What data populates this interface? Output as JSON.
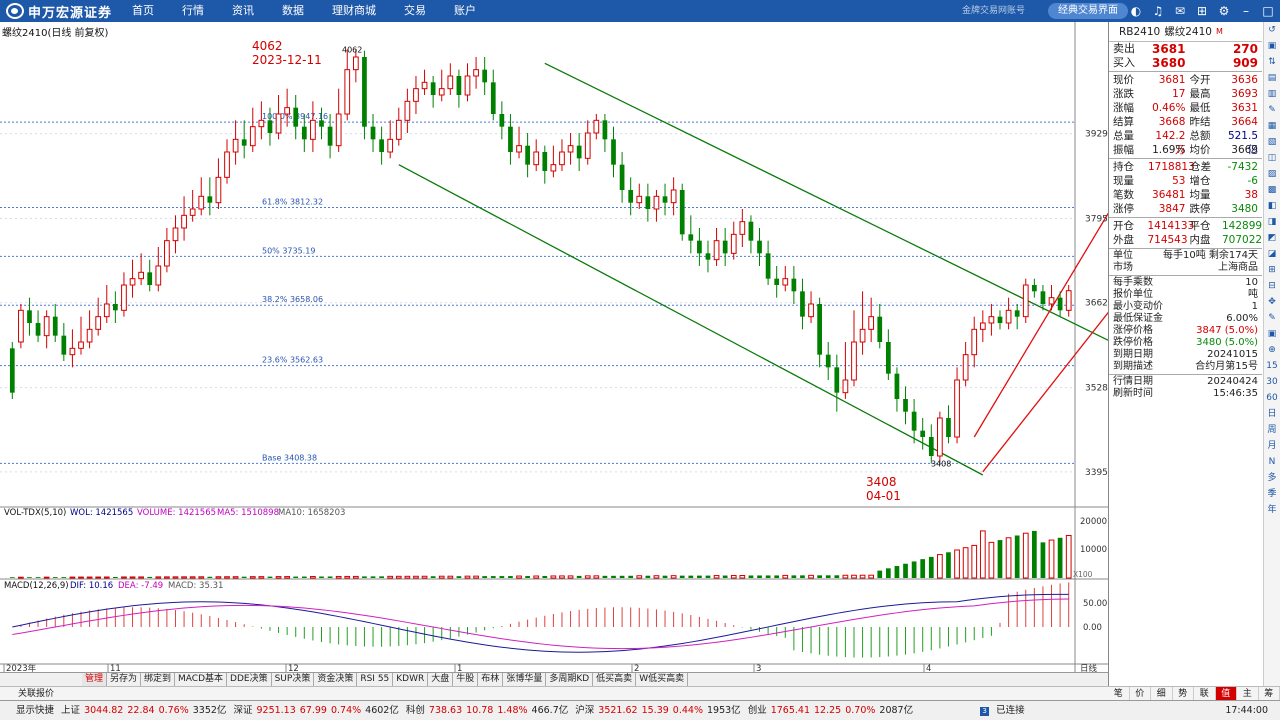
{
  "app": {
    "brand": "申万宏源证券",
    "nav": [
      "首页",
      "行情",
      "资讯",
      "数据",
      "理财商城",
      "交易",
      "账户"
    ],
    "top_small": "金牌交易网账号",
    "classic_btn": "经典交易界面"
  },
  "chart": {
    "title": "螺纹2410(日线 前复权)",
    "hi_label": "4062",
    "hi_date": "2023-12-11",
    "hi_tag": "4062",
    "lo_label": "3408",
    "lo_date": "04-01",
    "lo_tag": "3408",
    "price_axis": [
      "3929",
      "3795",
      "3662",
      "3528",
      "3395"
    ],
    "fib": [
      "100.0% 3947.16",
      "61.8% 3812.32",
      "50% 3735.19",
      "38.2% 3658.06",
      "23.6% 3562.63",
      "Base 3408.38"
    ],
    "vol_label": "VOL-TDX(5,10)",
    "wol": "WOL: 1421565",
    "volume": "VOLUME: 1421565",
    "ma5": "MA5: 1510898",
    "ma10": "MA10: 1658203",
    "vol_axis": [
      "20000",
      "10000",
      "X100"
    ],
    "macd_label": "MACD(12,26,9)",
    "dif": "DIF: 10.16",
    "dea": "DEA: -7.49",
    "macd": "MACD: 35.31",
    "macd_axis": [
      "50.00",
      "0.00"
    ],
    "months": [
      "2023年",
      "11",
      "12",
      "1",
      "2",
      "3",
      "4"
    ],
    "period": "日线"
  },
  "chart_data": {
    "type": "candlestick",
    "title": "螺纹2410(日线 前复权)",
    "ylim": [
      3360,
      4080
    ],
    "candles": [
      [
        3590,
        3520,
        3600,
        3510
      ],
      [
        3600,
        3650,
        3660,
        3590
      ],
      [
        3650,
        3630,
        3670,
        3610
      ],
      [
        3630,
        3610,
        3650,
        3600
      ],
      [
        3610,
        3640,
        3650,
        3590
      ],
      [
        3640,
        3610,
        3660,
        3600
      ],
      [
        3610,
        3580,
        3630,
        3570
      ],
      [
        3580,
        3590,
        3620,
        3560
      ],
      [
        3590,
        3600,
        3640,
        3580
      ],
      [
        3600,
        3620,
        3650,
        3590
      ],
      [
        3620,
        3640,
        3670,
        3610
      ],
      [
        3640,
        3660,
        3690,
        3630
      ],
      [
        3660,
        3650,
        3680,
        3630
      ],
      [
        3650,
        3690,
        3710,
        3640
      ],
      [
        3690,
        3700,
        3730,
        3670
      ],
      [
        3700,
        3710,
        3740,
        3690
      ],
      [
        3710,
        3690,
        3730,
        3680
      ],
      [
        3690,
        3720,
        3750,
        3680
      ],
      [
        3720,
        3760,
        3780,
        3710
      ],
      [
        3760,
        3780,
        3800,
        3740
      ],
      [
        3780,
        3800,
        3830,
        3760
      ],
      [
        3800,
        3810,
        3840,
        3790
      ],
      [
        3810,
        3830,
        3860,
        3800
      ],
      [
        3830,
        3820,
        3860,
        3800
      ],
      [
        3820,
        3860,
        3890,
        3810
      ],
      [
        3860,
        3900,
        3920,
        3850
      ],
      [
        3900,
        3920,
        3950,
        3880
      ],
      [
        3920,
        3910,
        3950,
        3890
      ],
      [
        3910,
        3940,
        3970,
        3900
      ],
      [
        3940,
        3950,
        3980,
        3920
      ],
      [
        3950,
        3930,
        3970,
        3910
      ],
      [
        3930,
        3960,
        3990,
        3920
      ],
      [
        3960,
        3970,
        4000,
        3940
      ],
      [
        3970,
        3940,
        3990,
        3920
      ],
      [
        3940,
        3920,
        3960,
        3900
      ],
      [
        3920,
        3950,
        3980,
        3900
      ],
      [
        3950,
        3940,
        3970,
        3920
      ],
      [
        3940,
        3910,
        3960,
        3890
      ],
      [
        3910,
        3960,
        4000,
        3900
      ],
      [
        3960,
        4030,
        4062,
        3950
      ],
      [
        4030,
        4050,
        4062,
        4010
      ],
      [
        4050,
        3940,
        4060,
        3920
      ],
      [
        3940,
        3920,
        3960,
        3900
      ],
      [
        3920,
        3900,
        3940,
        3880
      ],
      [
        3900,
        3920,
        3950,
        3890
      ],
      [
        3920,
        3950,
        3970,
        3910
      ],
      [
        3950,
        3980,
        4000,
        3930
      ],
      [
        3980,
        4000,
        4020,
        3960
      ],
      [
        4000,
        4010,
        4030,
        3990
      ],
      [
        4010,
        3990,
        4020,
        3970
      ],
      [
        3990,
        4000,
        4030,
        3980
      ],
      [
        4000,
        4020,
        4040,
        3990
      ],
      [
        4020,
        3990,
        4030,
        3970
      ],
      [
        3990,
        4020,
        4040,
        3980
      ],
      [
        4020,
        4030,
        4050,
        4000
      ],
      [
        4030,
        4010,
        4050,
        3990
      ],
      [
        4010,
        3960,
        4030,
        3950
      ],
      [
        3960,
        3940,
        3980,
        3920
      ],
      [
        3940,
        3900,
        3960,
        3880
      ],
      [
        3900,
        3910,
        3940,
        3890
      ],
      [
        3910,
        3880,
        3930,
        3860
      ],
      [
        3880,
        3900,
        3920,
        3870
      ],
      [
        3900,
        3870,
        3910,
        3850
      ],
      [
        3870,
        3880,
        3910,
        3860
      ],
      [
        3880,
        3900,
        3920,
        3870
      ],
      [
        3900,
        3910,
        3930,
        3880
      ],
      [
        3910,
        3890,
        3930,
        3870
      ],
      [
        3890,
        3930,
        3950,
        3880
      ],
      [
        3930,
        3950,
        3960,
        3920
      ],
      [
        3950,
        3920,
        3960,
        3900
      ],
      [
        3920,
        3880,
        3940,
        3860
      ],
      [
        3880,
        3840,
        3900,
        3820
      ],
      [
        3840,
        3820,
        3860,
        3800
      ],
      [
        3820,
        3830,
        3850,
        3810
      ],
      [
        3830,
        3810,
        3850,
        3790
      ],
      [
        3810,
        3830,
        3840,
        3790
      ],
      [
        3830,
        3820,
        3850,
        3800
      ],
      [
        3820,
        3840,
        3860,
        3800
      ],
      [
        3840,
        3770,
        3850,
        3760
      ],
      [
        3770,
        3760,
        3800,
        3740
      ],
      [
        3760,
        3740,
        3780,
        3720
      ],
      [
        3740,
        3730,
        3760,
        3710
      ],
      [
        3730,
        3760,
        3780,
        3720
      ],
      [
        3760,
        3740,
        3780,
        3720
      ],
      [
        3740,
        3770,
        3790,
        3730
      ],
      [
        3770,
        3790,
        3810,
        3750
      ],
      [
        3790,
        3760,
        3800,
        3740
      ],
      [
        3760,
        3740,
        3780,
        3720
      ],
      [
        3740,
        3700,
        3760,
        3690
      ],
      [
        3700,
        3690,
        3720,
        3670
      ],
      [
        3690,
        3700,
        3720,
        3680
      ],
      [
        3700,
        3680,
        3720,
        3660
      ],
      [
        3680,
        3640,
        3700,
        3620
      ],
      [
        3640,
        3660,
        3680,
        3630
      ],
      [
        3660,
        3580,
        3670,
        3560
      ],
      [
        3580,
        3560,
        3600,
        3540
      ],
      [
        3560,
        3520,
        3580,
        3490
      ],
      [
        3520,
        3540,
        3600,
        3510
      ],
      [
        3540,
        3600,
        3650,
        3530
      ],
      [
        3600,
        3620,
        3680,
        3580
      ],
      [
        3620,
        3640,
        3670,
        3600
      ],
      [
        3640,
        3600,
        3660,
        3590
      ],
      [
        3600,
        3550,
        3620,
        3540
      ],
      [
        3550,
        3510,
        3560,
        3490
      ],
      [
        3510,
        3490,
        3530,
        3470
      ],
      [
        3490,
        3460,
        3510,
        3440
      ],
      [
        3460,
        3450,
        3480,
        3430
      ],
      [
        3450,
        3420,
        3470,
        3408
      ],
      [
        3420,
        3480,
        3490,
        3410
      ],
      [
        3480,
        3450,
        3500,
        3440
      ],
      [
        3450,
        3540,
        3560,
        3440
      ],
      [
        3540,
        3580,
        3600,
        3530
      ],
      [
        3580,
        3620,
        3640,
        3560
      ],
      [
        3620,
        3630,
        3650,
        3600
      ],
      [
        3630,
        3640,
        3660,
        3610
      ],
      [
        3640,
        3630,
        3650,
        3620
      ],
      [
        3630,
        3650,
        3670,
        3620
      ],
      [
        3650,
        3640,
        3660,
        3620
      ],
      [
        3640,
        3690,
        3700,
        3630
      ],
      [
        3690,
        3680,
        3700,
        3670
      ],
      [
        3680,
        3660,
        3690,
        3650
      ],
      [
        3660,
        3670,
        3690,
        3650
      ],
      [
        3670,
        3650,
        3680,
        3640
      ],
      [
        3650,
        3681,
        3690,
        3640
      ]
    ]
  },
  "quote": {
    "code": "RB2410",
    "name": "螺纹2410",
    "mark": "M",
    "sell_l": "卖出",
    "sell_p": "3681",
    "sell_v": "270",
    "buy_l": "买入",
    "buy_p": "3680",
    "buy_v": "909",
    "rows": [
      [
        "现价",
        "3681",
        "今开",
        "3636"
      ],
      [
        "涨跌",
        "17",
        "最高",
        "3693"
      ],
      [
        "涨幅",
        "0.46%",
        "最低",
        "3631"
      ],
      [
        "结算",
        "3668",
        "昨结",
        "3664"
      ],
      [
        "总量",
        "142.2万",
        "总额",
        "521.5亿"
      ],
      [
        "振幅",
        "1.69%",
        "均价",
        "3669"
      ],
      [
        "持仓",
        "1718813",
        "仓差",
        "-7432"
      ],
      [
        "现量",
        "53",
        "增仓",
        "-6"
      ],
      [
        "笔数",
        "36481",
        "均量",
        "38"
      ],
      [
        "涨停",
        "3847",
        "跌停",
        "3480"
      ],
      [
        "开仓",
        "1414133",
        "平仓",
        "1428997"
      ],
      [
        "外盘",
        "714543",
        "内盘",
        "707022"
      ]
    ],
    "unit_l": "单位",
    "unit_v": "每手10吨",
    "remain": "剩余174天",
    "market_l": "市场",
    "market_v": "上海商品",
    "info": [
      [
        "每手乘数",
        "10"
      ],
      [
        "报价单位",
        "吨"
      ],
      [
        "最小变动价",
        "1"
      ],
      [
        "最低保证金",
        "6.00%"
      ],
      [
        "涨停价格",
        "3847 (5.0%)"
      ],
      [
        "跌停价格",
        "3480 (5.0%)"
      ],
      [
        "到期日期",
        "20241015"
      ],
      [
        "到期描述",
        "合约月第15号"
      ]
    ],
    "date_l": "行情日期",
    "date_v": "20240424",
    "time_l": "刷新时间",
    "time_v": "15:46:35"
  },
  "bottom_tabs": [
    "管理",
    "另存为",
    "绑定到",
    "MACD基本",
    "DDE决策",
    "SUP决策",
    "资金决策",
    "RSI 55",
    "KDWR",
    "大盘",
    "牛股",
    "布林",
    "张博华量",
    "多周期KD",
    "低买高卖",
    "W低买高卖"
  ],
  "rel_bar": "关联报价",
  "panel_tabs": [
    "笔",
    "价",
    "细",
    "势",
    "联",
    "值",
    "主",
    "筹"
  ],
  "right_tools": [
    "↺",
    "▣",
    "⇅",
    "▤",
    "▥",
    "✎",
    "▦",
    "▧",
    "◫",
    "▨",
    "▩",
    "◧",
    "◨",
    "◩",
    "◪",
    "⊞",
    "⊟",
    "✥",
    "✎",
    "▣",
    "⊕",
    "15",
    "30",
    "60",
    "日",
    "周",
    "月",
    "N",
    "多",
    "季",
    "年"
  ],
  "status": {
    "quick": "显示快捷",
    "sh_l": "上证",
    "sh_v": "3044.82",
    "sh_c": "22.84",
    "sh_p": "0.76%",
    "sh_a": "3352亿",
    "sz_l": "深证",
    "sz_v": "9251.13",
    "sz_c": "67.99",
    "sz_p": "0.74%",
    "sz_a": "4602亿",
    "kc_l": "科创",
    "kc_v": "738.63",
    "kc_c": "10.78",
    "kc_p": "1.48%",
    "kc_a": "466.7亿",
    "hs_l": "沪深",
    "hs_v": "3521.62",
    "hs_c": "15.39",
    "hs_p": "0.44%",
    "hs_a": "1953亿",
    "cy_l": "创业",
    "cy_v": "1765.41",
    "cy_c": "12.25",
    "cy_p": "0.70%",
    "cy_a": "2087亿",
    "conn": "已连接",
    "time": "17:44:00"
  }
}
